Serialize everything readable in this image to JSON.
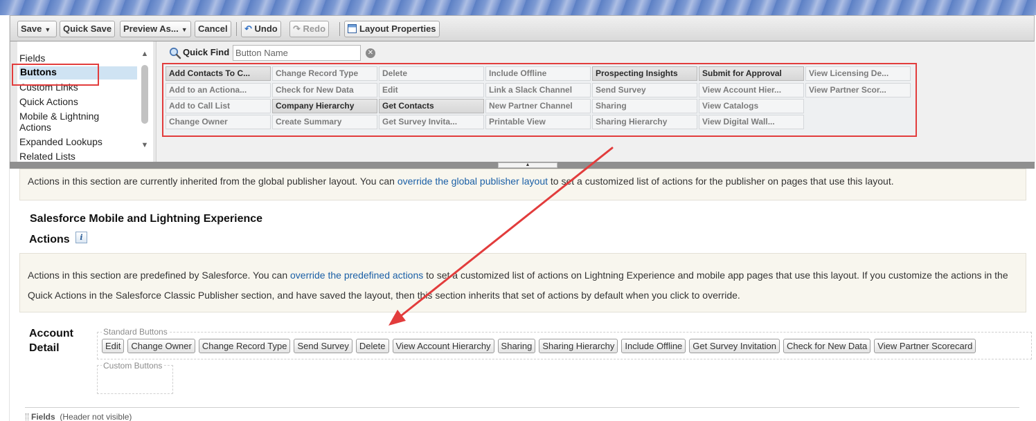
{
  "toolbar": {
    "save": "Save",
    "quick_save": "Quick Save",
    "preview_as": "Preview As...",
    "cancel": "Cancel",
    "undo": "Undo",
    "redo": "Redo",
    "layout_properties": "Layout Properties"
  },
  "palette": {
    "categories": [
      "Fields",
      "Buttons",
      "Custom Links",
      "Quick Actions",
      "Mobile & Lightning",
      "Actions",
      "Expanded Lookups",
      "Related Lists"
    ],
    "selected_category": "Buttons",
    "quick_find_label": "Quick Find",
    "quick_find_placeholder": "Button Name",
    "buttons": [
      "Add Contacts To C...",
      "Add to an Actiona...",
      "Add to Call List",
      "Change Owner",
      "Change Record Type",
      "Check for New Data",
      "Company Hierarchy",
      "Create Summary",
      "Delete",
      "Edit",
      "Get Contacts",
      "Get Survey Invita...",
      "Include Offline",
      "Link a Slack Channel",
      "New Partner Channel",
      "Printable View",
      "Prospecting Insights",
      "Send Survey",
      "Sharing",
      "Sharing Hierarchy",
      "Submit for Approval",
      "View Account Hier...",
      "View Catalogs",
      "View Digital Wall...",
      "View Licensing De...",
      "View Partner Scor..."
    ]
  },
  "main": {
    "inherited_note_before": "Actions in this section are currently inherited from the global publisher layout. You can ",
    "inherited_note_link": "override the global publisher layout",
    "inherited_note_after": " to set a customized list of actions for the publisher on pages that use this layout.",
    "mobile_section_title": "Salesforce Mobile and Lightning Experience",
    "mobile_section_subtitle": "Actions",
    "predefined_note_before": "Actions in this section are predefined by Salesforce. You can ",
    "predefined_note_link": "override the predefined actions",
    "predefined_note_after": " to set a customized list of actions on Lightning Experience and mobile app pages that use this layout. If you customize the actions in the Quick Actions in the Salesforce Classic Publisher section, and have saved the layout, then this section inherits that set of actions by default when you click to override.",
    "account_detail_line1": "Account",
    "account_detail_line2": "Detail",
    "standard_buttons_title": "Standard Buttons",
    "standard_buttons": [
      "Edit",
      "Change Owner",
      "Change Record Type",
      "Send Survey",
      "Delete",
      "View Account Hierarchy",
      "Sharing",
      "Sharing Hierarchy",
      "Include Offline",
      "Get Survey Invitation",
      "Check for New Data",
      "View Partner Scorecard"
    ],
    "custom_buttons_title": "Custom Buttons",
    "fields_label": "Fields",
    "fields_sublabel": "(Header not visible)"
  },
  "colors": {
    "highlight_red": "#e23c3c",
    "link_blue": "#1a5fa6",
    "selected_bg": "#cfe3f3"
  }
}
